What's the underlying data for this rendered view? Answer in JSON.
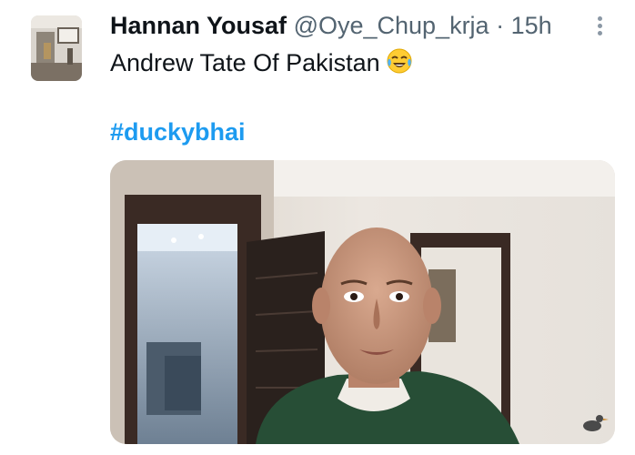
{
  "tweet": {
    "author": {
      "display_name": "Hannan Yousaf",
      "handle": "@Oye_Chup_krja",
      "separator": "·",
      "time": "15h"
    },
    "text": "Andrew Tate Of Pakistan",
    "emoji": "face-with-tears-of-joy",
    "hashtag": "#duckybhai",
    "more_icon": "more-vertical-icon"
  },
  "colors": {
    "text_primary": "#0f1419",
    "text_secondary": "#536471",
    "link": "#1d9bf0"
  }
}
